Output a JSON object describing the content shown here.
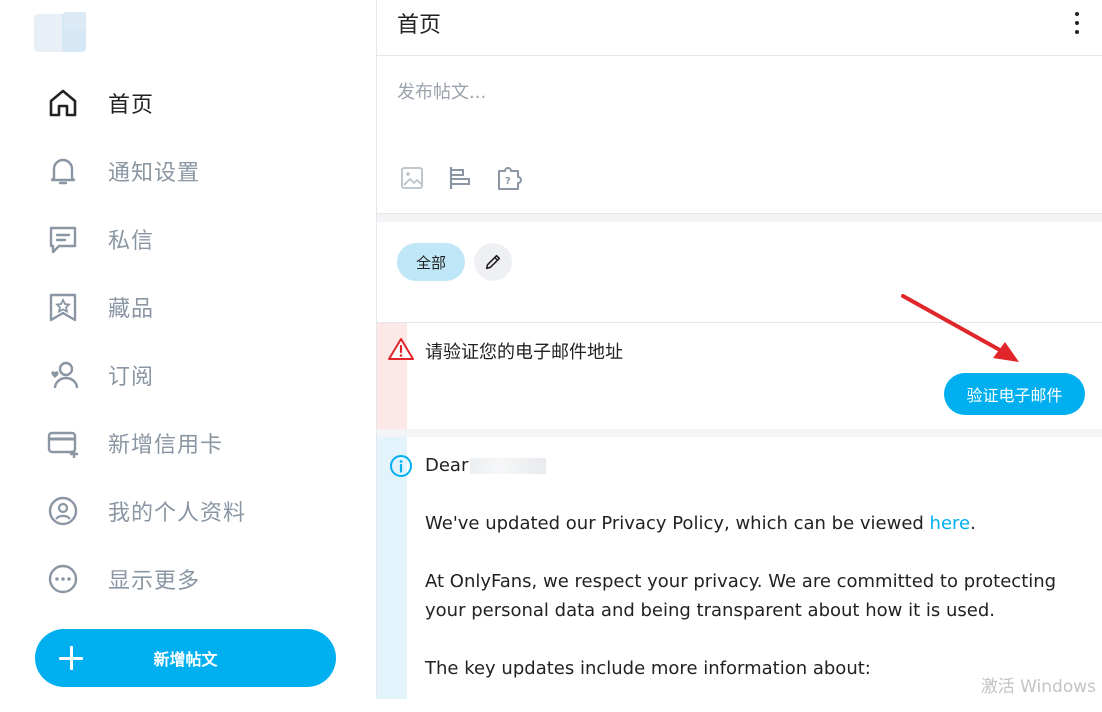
{
  "sidebar": {
    "items": [
      {
        "label": "首页",
        "icon": "home-icon",
        "active": true
      },
      {
        "label": "通知设置",
        "icon": "bell-icon"
      },
      {
        "label": "私信",
        "icon": "message-icon"
      },
      {
        "label": "藏品",
        "icon": "bookmark-icon"
      },
      {
        "label": "订阅",
        "icon": "subscriptions-icon"
      },
      {
        "label": "新增信用卡",
        "icon": "credit-card-add-icon"
      },
      {
        "label": "我的个人资料",
        "icon": "profile-icon"
      },
      {
        "label": "显示更多",
        "icon": "more-circle-icon"
      }
    ],
    "new_post_label": "新增帖文"
  },
  "header": {
    "title": "首页"
  },
  "composer": {
    "placeholder": "发布帖文..."
  },
  "filters": {
    "all_label": "全部"
  },
  "alert": {
    "message": "请验证您的电子邮件地址",
    "button_label": "验证电子邮件"
  },
  "notice": {
    "greeting": "Dear",
    "line1_before": "We've updated our Privacy Policy, which can be viewed ",
    "line1_link": "here",
    "line1_after": ".",
    "line2": "At OnlyFans, we respect your privacy. We are committed to protecting your personal data and being transparent about how it is used.",
    "line3": "The key updates include more information about:"
  },
  "colors": {
    "accent": "#00aff0",
    "alert_bg": "#fde8e8",
    "info_bg": "#e3f3fc",
    "annotation_arrow": "#e0262a"
  },
  "watermark": "激活 Windows"
}
